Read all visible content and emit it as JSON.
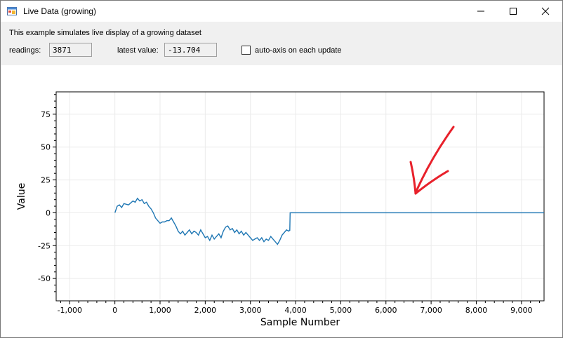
{
  "window": {
    "title": "Live Data (growing)"
  },
  "form": {
    "description": "This example simulates live display of a growing dataset",
    "readings_label": "readings:",
    "readings_value": "3871",
    "latest_label": "latest value:",
    "latest_value": "-13.704",
    "autoaxis_label": "auto-axis on each update",
    "autoaxis_checked": false
  },
  "chart_data": {
    "type": "line",
    "title": "",
    "xlabel": "Sample Number",
    "ylabel": "Value",
    "xlim": [
      -1300,
      9500
    ],
    "ylim": [
      -67,
      92
    ],
    "x_ticks": [
      {
        "value": -1000,
        "label": "-1,000"
      },
      {
        "value": 0,
        "label": "0"
      },
      {
        "value": 1000,
        "label": "1,000"
      },
      {
        "value": 2000,
        "label": "2,000"
      },
      {
        "value": 3000,
        "label": "3,000"
      },
      {
        "value": 4000,
        "label": "4,000"
      },
      {
        "value": 5000,
        "label": "5,000"
      },
      {
        "value": 6000,
        "label": "6,000"
      },
      {
        "value": 7000,
        "label": "7,000"
      },
      {
        "value": 8000,
        "label": "8,000"
      },
      {
        "value": 9000,
        "label": "9,000"
      }
    ],
    "y_ticks": [
      {
        "value": 75,
        "label": "75"
      },
      {
        "value": 50,
        "label": "50"
      },
      {
        "value": 25,
        "label": "25"
      },
      {
        "value": 0,
        "label": "0"
      },
      {
        "value": -25,
        "label": "-25"
      },
      {
        "value": -50,
        "label": "-50"
      }
    ],
    "grid": true,
    "line_color": "#1f77b4",
    "series": [
      {
        "x": [
          0,
          50,
          100,
          150,
          200,
          300,
          400,
          450,
          500,
          550,
          600,
          650,
          700,
          750,
          800,
          850,
          900,
          950,
          1000,
          1050,
          1100,
          1150,
          1200,
          1250,
          1300,
          1350,
          1400,
          1450,
          1500,
          1550,
          1600,
          1650,
          1700,
          1750,
          1800,
          1850,
          1900,
          1950,
          2000,
          2050,
          2100,
          2150,
          2200,
          2250,
          2300,
          2350,
          2400,
          2450,
          2500,
          2550,
          2600,
          2650,
          2700,
          2750,
          2800,
          2850,
          2900,
          2950,
          3000,
          3050,
          3100,
          3150,
          3200,
          3250,
          3300,
          3350,
          3400,
          3450,
          3500,
          3550,
          3600,
          3650,
          3700,
          3750,
          3800,
          3850,
          3870,
          3871,
          3880,
          9500
        ],
        "y": [
          0,
          5,
          6,
          4,
          7,
          6,
          9,
          8,
          11,
          9,
          10,
          7,
          8,
          5,
          3,
          0,
          -4,
          -6,
          -8,
          -7,
          -7,
          -6,
          -6,
          -4,
          -7,
          -10,
          -14,
          -16,
          -14,
          -17,
          -15,
          -13,
          -16,
          -14,
          -15,
          -17,
          -13,
          -16,
          -19,
          -18,
          -21,
          -17,
          -20,
          -18,
          -16,
          -19,
          -14,
          -11,
          -10,
          -13,
          -12,
          -15,
          -13,
          -16,
          -14,
          -17,
          -15,
          -17,
          -19,
          -21,
          -20,
          -19,
          -21,
          -19,
          -22,
          -20,
          -21,
          -18,
          -20,
          -22,
          -24,
          -21,
          -17,
          -15,
          -13,
          -14,
          -13,
          -13.704,
          0,
          0
        ]
      }
    ],
    "annotation": {
      "type": "handdrawn-arrow",
      "color": "#e8212b"
    }
  }
}
